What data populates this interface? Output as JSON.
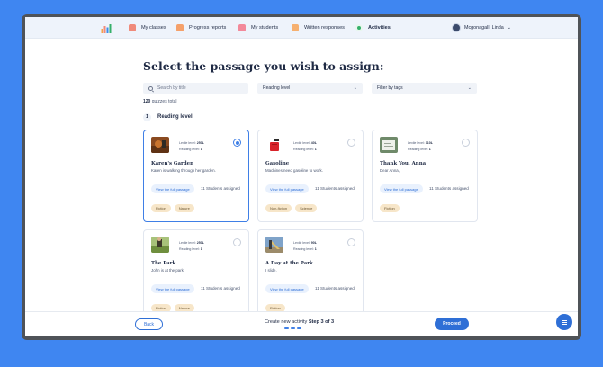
{
  "nav": {
    "items": [
      {
        "label": "My classes",
        "icon": "classes-icon"
      },
      {
        "label": "Progress reports",
        "icon": "progress-icon"
      },
      {
        "label": "My students",
        "icon": "students-icon"
      },
      {
        "label": "Written responses",
        "icon": "written-icon"
      },
      {
        "label": "Activities",
        "icon": "activities-check-icon"
      }
    ],
    "active": "Activities",
    "user_name": "Mcgonagall, Linda"
  },
  "page": {
    "title": "Select the passage you wish to assign:",
    "search_placeholder": "Search by title",
    "reading_level_select": "Reading level",
    "tags_select": "Filter by tags",
    "total_count": "120",
    "total_suffix": "quizzes total"
  },
  "group": {
    "number": "1",
    "label": "Reading level"
  },
  "cards": [
    {
      "lexile_prefix": "Lexile level:",
      "lexile": "250L",
      "reading_prefix": "Reading level:",
      "reading": "1",
      "title": "Karen's Garden",
      "summary": "Karen is walking through her garden.",
      "view_label": "View the full passage",
      "assigned": "11 Students assigned",
      "tags": [
        "Fiction",
        "Nature"
      ],
      "selected": true,
      "thumb": "garden-thumbnail"
    },
    {
      "lexile_prefix": "Lexile level:",
      "lexile": "40L",
      "reading_prefix": "Reading level:",
      "reading": "1",
      "title": "Gasoline",
      "summary": "Machines need gasoline to work.",
      "view_label": "View the full passage",
      "assigned": "11 Students assigned",
      "tags": [
        "Non-fiction",
        "Science"
      ],
      "selected": false,
      "thumb": "gas-can-thumbnail"
    },
    {
      "lexile_prefix": "Lexile level:",
      "lexile": "310L",
      "reading_prefix": "Reading level:",
      "reading": "1",
      "title": "Thank You, Anna",
      "summary": "Dear Anna,",
      "view_label": "View the full passage",
      "assigned": "11 Students assigned",
      "tags": [
        "Fiction"
      ],
      "selected": false,
      "thumb": "letter-thumbnail"
    },
    {
      "lexile_prefix": "Lexile level:",
      "lexile": "250L",
      "reading_prefix": "Reading level:",
      "reading": "1",
      "title": "The Park",
      "summary": "John is at the park.",
      "view_label": "View the full passage",
      "assigned": "11 Students assigned",
      "tags": [
        "Fiction",
        "Nature"
      ],
      "selected": false,
      "thumb": "park-thumbnail"
    },
    {
      "lexile_prefix": "Lexile level:",
      "lexile": "90L",
      "reading_prefix": "Reading level:",
      "reading": "1",
      "title": "A Day at the Park",
      "summary": "I slide.",
      "view_label": "View the full passage",
      "assigned": "11 Students assigned",
      "tags": [
        "Fiction"
      ],
      "selected": false,
      "thumb": "slide-thumbnail"
    }
  ],
  "footer": {
    "back_label": "Back",
    "step_prefix": "Create new activity",
    "step_text": "Step 3 of 3",
    "proceed_label": "Proceed"
  },
  "colors": {
    "primary": "#2f6fd6",
    "background": "#3f86f1",
    "tag": "#f7e6c9"
  }
}
